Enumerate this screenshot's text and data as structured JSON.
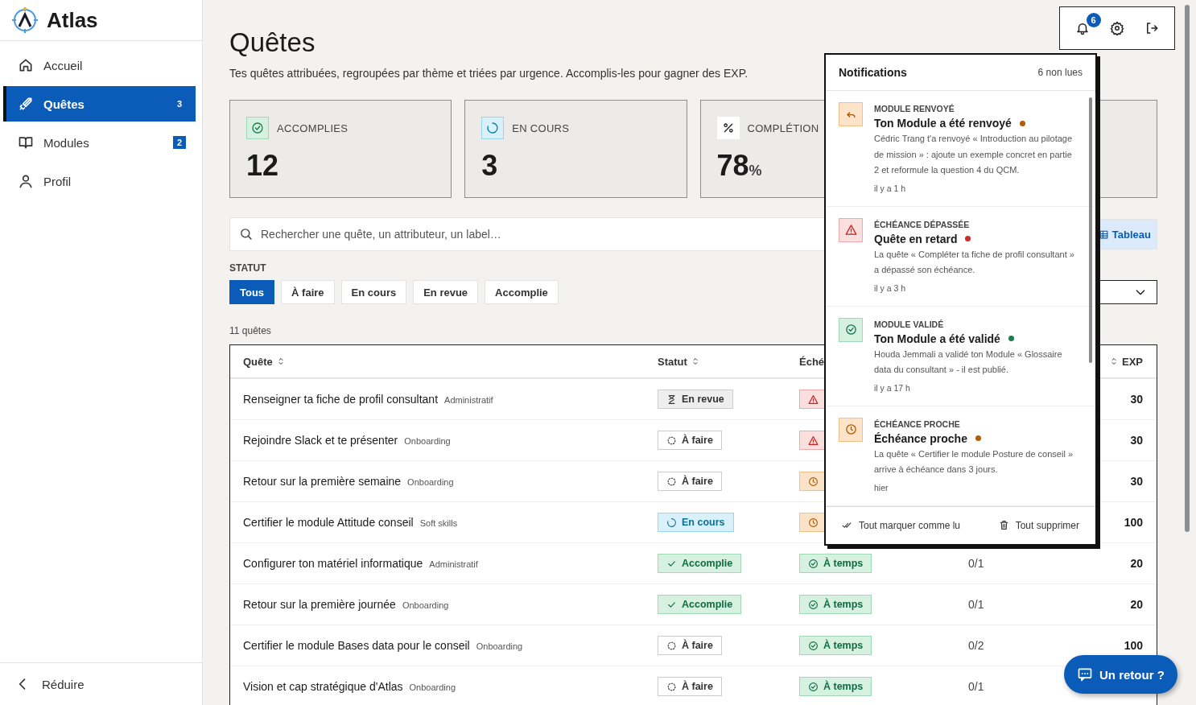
{
  "sidebar": {
    "brand": "Atlas",
    "items": [
      {
        "label": "Accueil",
        "selected": false
      },
      {
        "label": "Quêtes",
        "badge": "3",
        "selected": true
      },
      {
        "label": "Modules",
        "badge": "2",
        "selected": false
      },
      {
        "label": "Profil",
        "selected": false
      }
    ],
    "collapse": "Réduire"
  },
  "toolbar": {
    "notification_count": "6"
  },
  "page": {
    "title": "Quêtes",
    "subtitle": "Tes quêtes attribuées, regroupées par thème et triées par urgence. Accomplis-les pour gagner des EXP."
  },
  "stats": [
    {
      "kind": "done",
      "label": "ACCOMPLIES",
      "value": "12"
    },
    {
      "kind": "progress",
      "label": "EN COURS",
      "value": "3"
    },
    {
      "kind": "percent",
      "label": "COMPLÉTION",
      "value": "78",
      "unit": "%"
    }
  ],
  "search": {
    "placeholder": "Rechercher une quête, un attributeur, un label…"
  },
  "view_toggle": [
    {
      "label": "Tableau",
      "selected": true
    }
  ],
  "filters": {
    "label": "STATUT",
    "chips": [
      {
        "label": "Tous",
        "selected": true
      },
      {
        "label": "À faire",
        "selected": false
      },
      {
        "label": "En cours",
        "selected": false
      },
      {
        "label": "En revue",
        "selected": false
      },
      {
        "label": "Accomplie",
        "selected": false
      }
    ]
  },
  "count": "11 quêtes",
  "table": {
    "columns": [
      {
        "label": "Quête",
        "sortable": true
      },
      {
        "label": "Statut",
        "sortable": true
      },
      {
        "label": "Éché"
      },
      {
        "label": "EXP",
        "sortable": true
      }
    ],
    "rows": [
      {
        "title": "Renseigner ta fiche de profil consultant",
        "tag": "Administratif",
        "status": {
          "kind": "review",
          "label": "En revue"
        },
        "deadline": {
          "kind": "late"
        },
        "exp": "30"
      },
      {
        "title": "Rejoindre Slack et te présenter",
        "tag": "Onboarding",
        "status": {
          "kind": "todo",
          "label": "À faire"
        },
        "deadline": {
          "kind": "late"
        },
        "exp": "30"
      },
      {
        "title": "Retour sur la première semaine",
        "tag": "Onboarding",
        "status": {
          "kind": "todo",
          "label": "À faire"
        },
        "deadline": {
          "kind": "soon"
        },
        "exp": "30"
      },
      {
        "title": "Certifier le module Attitude conseil",
        "tag": "Soft skills",
        "status": {
          "kind": "in_progress",
          "label": "En cours"
        },
        "deadline": {
          "kind": "soon"
        },
        "exp": "100"
      },
      {
        "title": "Configurer ton matériel informatique",
        "tag": "Administratif",
        "status": {
          "kind": "done",
          "label": "Accomplie"
        },
        "deadline": {
          "kind": "on_time",
          "label": "À temps"
        },
        "progress": "0/1",
        "exp": "20"
      },
      {
        "title": "Retour sur la première journée",
        "tag": "Onboarding",
        "status": {
          "kind": "done",
          "label": "Accomplie"
        },
        "deadline": {
          "kind": "on_time",
          "label": "À temps"
        },
        "progress": "0/1",
        "exp": "20"
      },
      {
        "title": "Certifier le module Bases data pour le conseil",
        "tag": "Onboarding",
        "status": {
          "kind": "todo",
          "label": "À faire"
        },
        "deadline": {
          "kind": "on_time",
          "label": "À temps"
        },
        "progress": "0/2",
        "exp": "100"
      },
      {
        "title": "Vision et cap stratégique d'Atlas",
        "tag": "Onboarding",
        "status": {
          "kind": "todo",
          "label": "À faire"
        },
        "deadline": {
          "kind": "on_time",
          "label": "À temps"
        },
        "progress": "0/1"
      }
    ]
  },
  "notifications": {
    "title": "Notifications",
    "unread": "6 non lues",
    "items": [
      {
        "kind": "returned",
        "category": "MODULE RENVOYÉ",
        "title": "Ton Module a été renvoyé",
        "color": "#b35c00",
        "body": "Cédric Trang t'a renvoyé « Introduction au pilotage de mission » : ajoute un exemple concret en partie 2 et reformule la question 4 du QCM.",
        "time": "il y a 1 h"
      },
      {
        "kind": "late",
        "category": "ÉCHÉANCE DÉPASSÉE",
        "title": "Quête en retard",
        "color": "#d42a2a",
        "body": "La quête « Compléter ta fiche de profil consultant » a dépassé son échéance.",
        "time": "il y a 3 h"
      },
      {
        "kind": "validated",
        "category": "MODULE VALIDÉ",
        "title": "Ton Module a été validé",
        "color": "#16804f",
        "body": "Houda Jemmali a validé ton Module « Glossaire data du consultant » - il est publié.",
        "time": "il y a 17 h"
      },
      {
        "kind": "soon",
        "category": "ÉCHÉANCE PROCHE",
        "title": "Échéance proche",
        "color": "#b35c00",
        "body": "La quête « Certifier le module Posture de conseil » arrive à échéance dans 3 jours.",
        "time": "hier"
      }
    ],
    "actions": [
      "Tout marquer comme lu",
      "Tout supprimer"
    ]
  },
  "feedback": {
    "label": "Un retour ?"
  }
}
